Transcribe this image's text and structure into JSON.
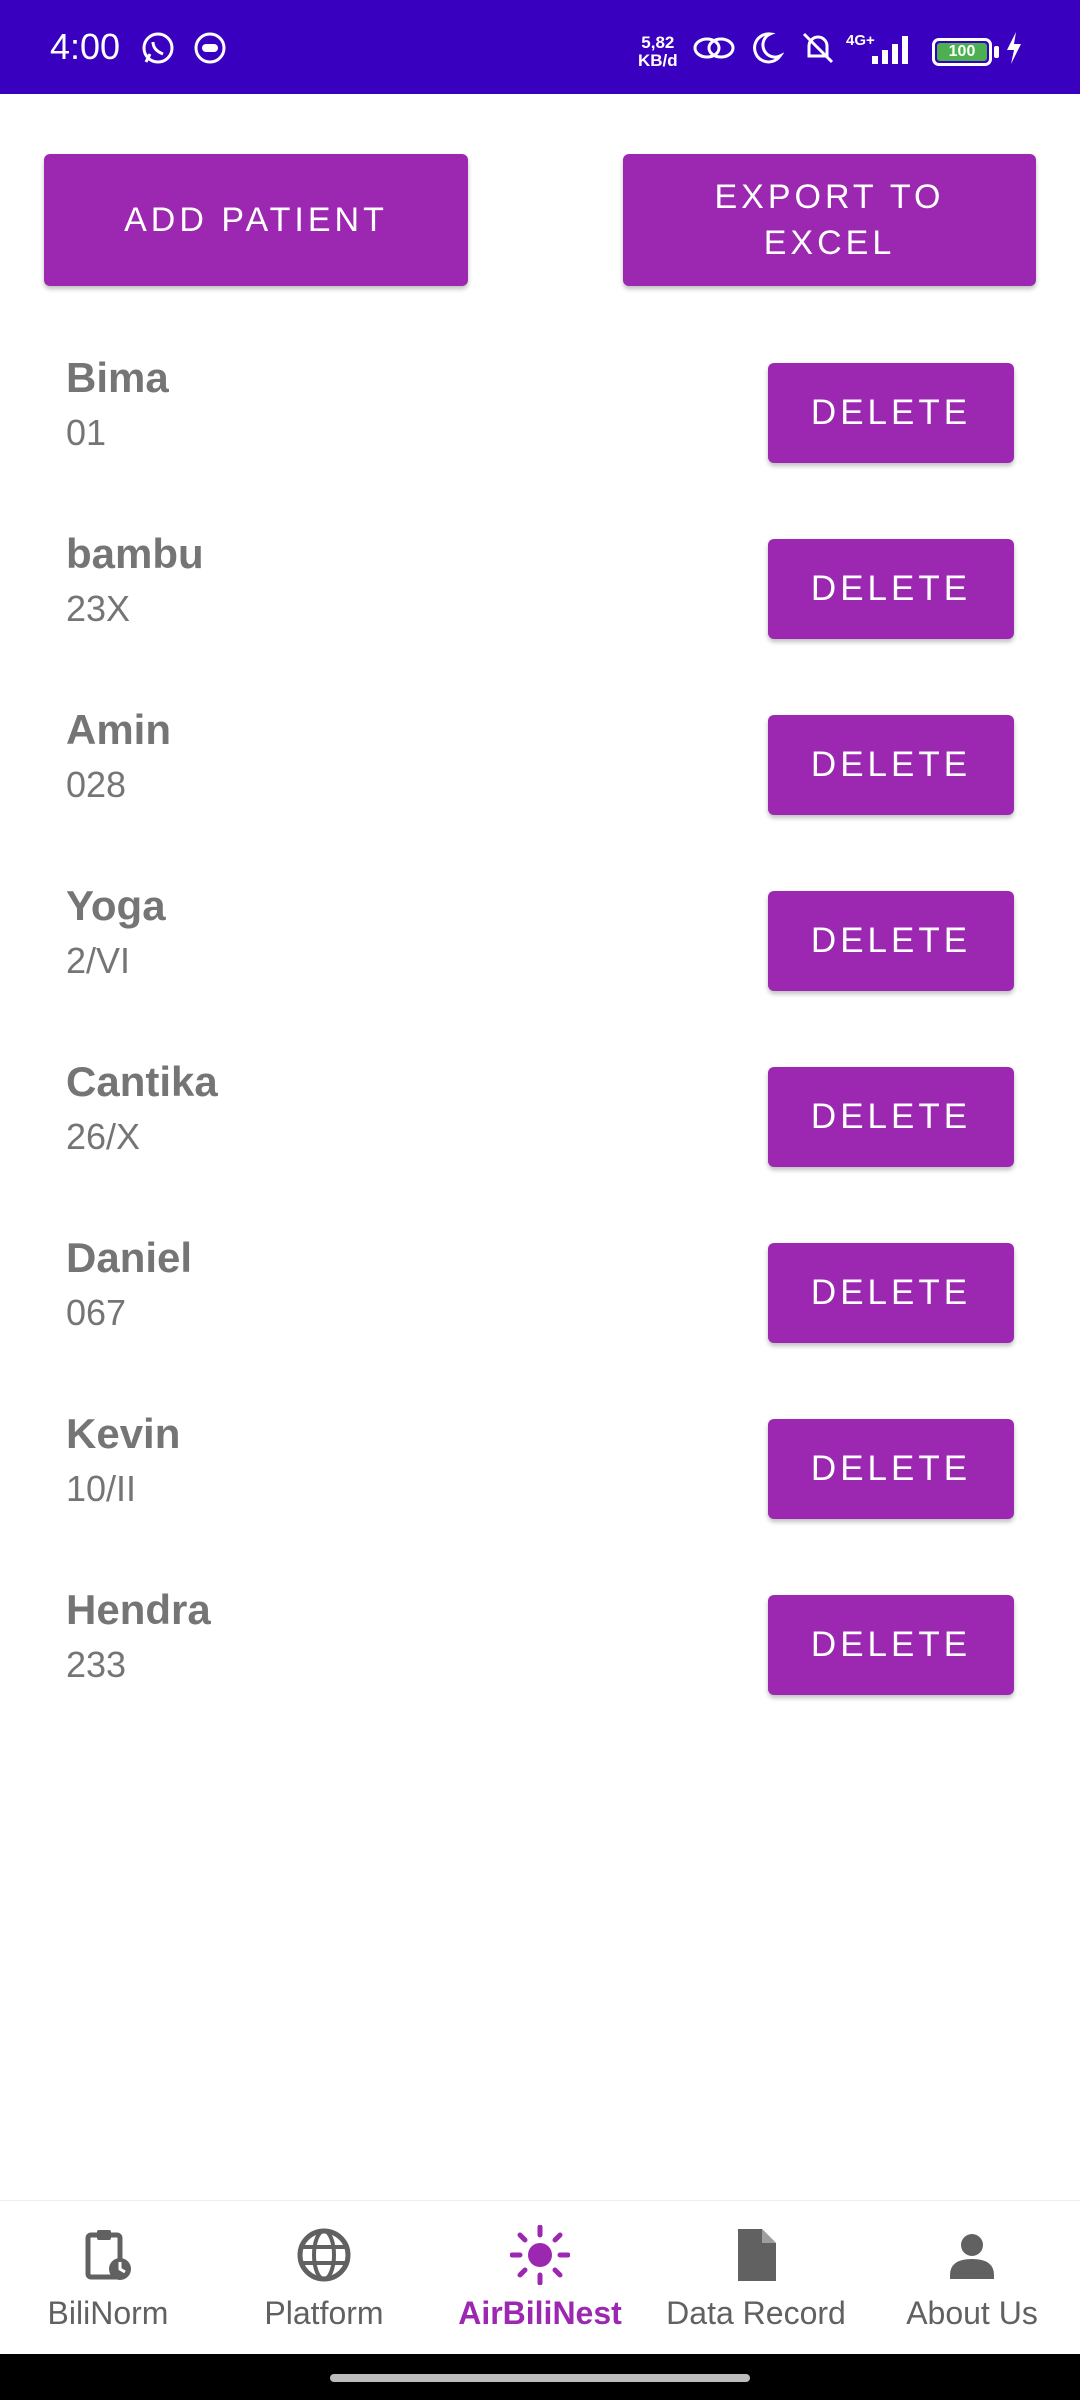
{
  "status_bar": {
    "time": "4:00",
    "network_speed": "5,82\nKB/d",
    "network_speed_top": "5,82",
    "network_speed_bottom": "KB/d",
    "network_type": "4G+",
    "battery": "100",
    "icons": [
      "whatsapp-icon",
      "face-icon",
      "link-icon",
      "moon-icon",
      "bell-off-icon",
      "signal-icon",
      "battery-icon",
      "charging-icon"
    ],
    "color": "#3a00bf"
  },
  "toolbar": {
    "add_label": "ADD PATIENT",
    "export_label": "EXPORT TO EXCEL"
  },
  "patients": [
    {
      "name": "Bima",
      "id": "01",
      "delete_label": "DELETE"
    },
    {
      "name": "bambu",
      "id": "23X",
      "delete_label": "DELETE"
    },
    {
      "name": "Amin",
      "id": "028",
      "delete_label": "DELETE"
    },
    {
      "name": "Yoga",
      "id": "2/VI",
      "delete_label": "DELETE"
    },
    {
      "name": "Cantika",
      "id": "26/X",
      "delete_label": "DELETE"
    },
    {
      "name": "Daniel",
      "id": "067",
      "delete_label": "DELETE"
    },
    {
      "name": "Kevin",
      "id": "10/II",
      "delete_label": "DELETE"
    },
    {
      "name": "Hendra",
      "id": "233",
      "delete_label": "DELETE"
    }
  ],
  "bottom_nav": {
    "items": [
      {
        "label": "BiliNorm",
        "icon": "clipboard-clock-icon",
        "active": false
      },
      {
        "label": "Platform",
        "icon": "globe-icon",
        "active": false
      },
      {
        "label": "AirBiliNest",
        "icon": "sun-icon",
        "active": true
      },
      {
        "label": "Data Record",
        "icon": "file-icon",
        "active": false
      },
      {
        "label": "About Us",
        "icon": "person-icon",
        "active": false
      }
    ]
  },
  "colors": {
    "accent": "#9c27b0",
    "text_secondary": "#757575",
    "nav_inactive": "#616161"
  }
}
